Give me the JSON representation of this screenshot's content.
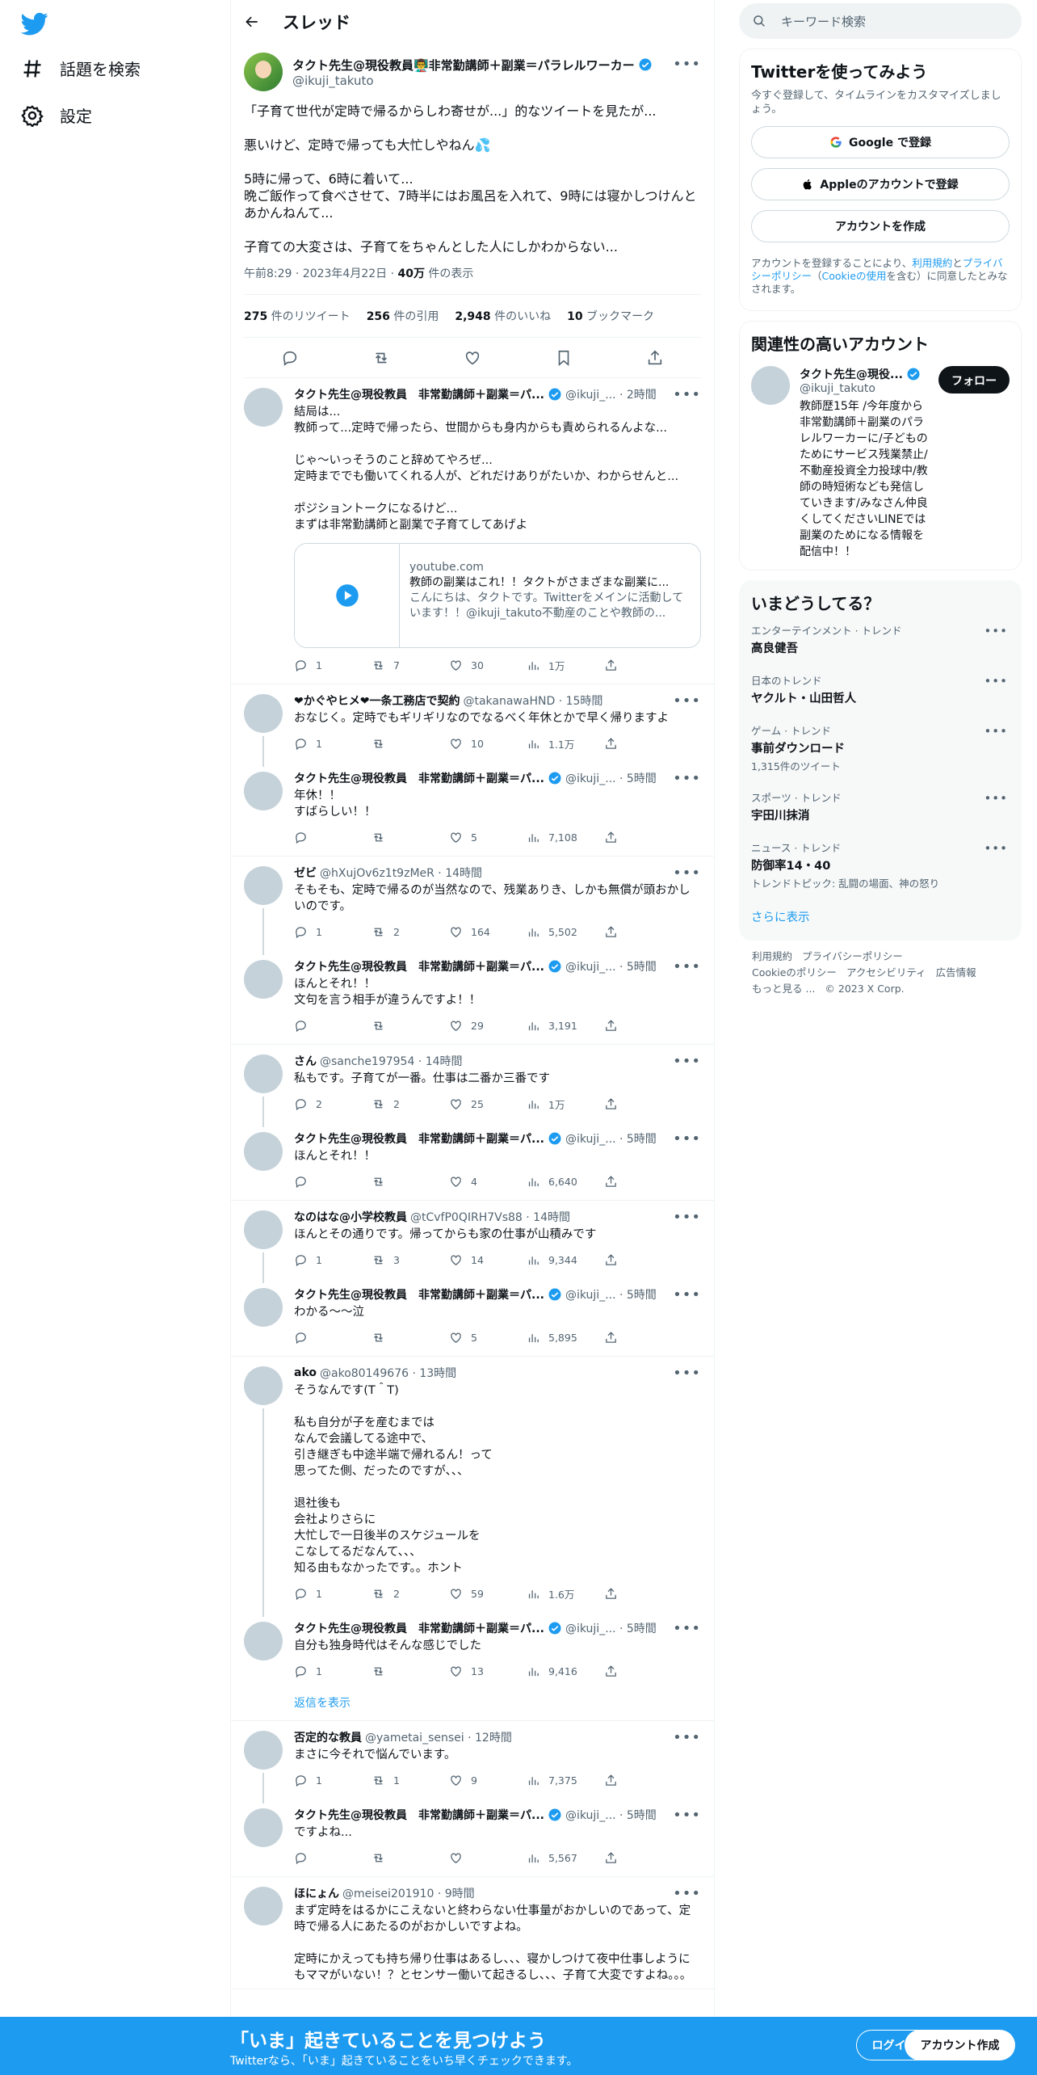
{
  "colors": {
    "accent": "#1d9bf0",
    "text": "#0f1419",
    "muted": "#536471"
  },
  "nav": {
    "explore": "話題を検索",
    "settings": "設定"
  },
  "header": {
    "title": "スレッド"
  },
  "focal": {
    "name": "タクト先生@現役教員👨‍🏫非常勤講師＋副業＝パラレルワーカー",
    "handle": "@ikuji_takuto",
    "text": "「子育て世代が定時で帰るからしわ寄せが...」的なツイートを見たが...\n\n悪いけど、定時で帰っても大忙しやねん💦\n\n5時に帰って、6時に着いて...\n晩ご飯作って食べさせて、7時半にはお風呂を入れて、9時には寝かしつけんとあかんねんて...\n\n子育ての大変さは、子育てをちゃんとした人にしかわからない...",
    "time": "午前8:29 · 2023年4月22日 · ",
    "views": "40万",
    "views_label": " 件の表示",
    "stats": [
      {
        "n": "275",
        "l": " 件のリツイート"
      },
      {
        "n": "256",
        "l": " 件の引用"
      },
      {
        "n": "2,948",
        "l": " 件のいいね"
      },
      {
        "n": "10",
        "l": " ブックマーク"
      }
    ]
  },
  "tweets": [
    {
      "name": "タクト先生@現役教員　非常勤講師＋副業＝パ...",
      "handle": "@ikuji_... · 2時間",
      "text": "結局は...\n教師って...定時で帰ったら、世間からも身内からも責められるんよな...\n\nじゃ〜いっそうのこと辞めてやろぜ...\n定時まででも働いてくれる人が、どれだけありがたいか、わからせんと...\n\nポジショントークになるけど...\nまずは非常勤講師と副業で子育てしてあげよ",
      "reply": "1",
      "rt": "7",
      "like": "30",
      "view": "1万",
      "card": {
        "domain": "youtube.com",
        "title": "教師の副業はこれ！！タクトがさまざまな副業に...",
        "desc": "こんにちは、タクトです。Twitterをメインに活動しています！！@ikuji_takuto不動産のことや教師の..."
      }
    },
    {
      "name": "❤かぐやヒメ❤一条工務店で契約",
      "handle": "@takanawaHND · 15時間",
      "text": "おなじく。定時でもギリギリなのでなるべく年休とかで早く帰りますよ",
      "reply": "1",
      "rt": "",
      "like": "10",
      "view": "1.1万"
    },
    {
      "name": "タクト先生@現役教員　非常勤講師＋副業＝パ...",
      "handle": "@ikuji_... · 5時間",
      "text": "年休！！\nすばらしい！！",
      "reply": "",
      "rt": "",
      "like": "5",
      "view": "7,108"
    },
    {
      "name": "ゼビ",
      "handle": "@hXujOv6z1t9zMeR · 14時間",
      "text": "そもそも、定時で帰るのが当然なので、残業ありき、しかも無償が頭おかしいのです。",
      "reply": "1",
      "rt": "2",
      "like": "164",
      "view": "5,502"
    },
    {
      "name": "タクト先生@現役教員　非常勤講師＋副業＝パ...",
      "handle": "@ikuji_... · 5時間",
      "text": "ほんとそれ！！\n文句を言う相手が違うんですよ！！",
      "reply": "",
      "rt": "",
      "like": "29",
      "view": "3,191"
    },
    {
      "name": "さん",
      "handle": "@sanche197954 · 14時間",
      "text": "私もです。子育てが一番。仕事は二番か三番です",
      "reply": "2",
      "rt": "2",
      "like": "25",
      "view": "1万"
    },
    {
      "name": "タクト先生@現役教員　非常勤講師＋副業＝パ...",
      "handle": "@ikuji_... · 5時間",
      "text": "ほんとそれ！！",
      "reply": "",
      "rt": "",
      "like": "4",
      "view": "6,640"
    },
    {
      "name": "なのはな@小学校教員",
      "handle": "@tCvfP0QIRH7Vs88 · 14時間",
      "text": "ほんとその通りです。帰ってからも家の仕事が山積みです",
      "reply": "1",
      "rt": "3",
      "like": "14",
      "view": "9,344"
    },
    {
      "name": "タクト先生@現役教員　非常勤講師＋副業＝パ...",
      "handle": "@ikuji_... · 5時間",
      "text": "わかる〜〜泣",
      "reply": "",
      "rt": "",
      "like": "5",
      "view": "5,895"
    },
    {
      "name": "ako",
      "handle": "@ako80149676 · 13時間",
      "text": "そうなんです(T＾T)\n\n私も自分が子を産むまでは\nなんで会議してる途中で、\n引き継ぎも中途半端で帰れるん！って\n思ってた側、だったのですが、、、\n\n退社後も\n会社よりさらに\n大忙しで一日後半のスケジュールを\nこなしてるだなんて、、、\n知る由もなかったです。。ホント",
      "reply": "1",
      "rt": "2",
      "like": "59",
      "view": "1.6万"
    },
    {
      "name": "タクト先生@現役教員　非常勤講師＋副業＝パ...",
      "handle": "@ikuji_... · 5時間",
      "text": "自分も独身時代はそんな感じでした",
      "reply": "1",
      "rt": "",
      "like": "13",
      "view": "9,416"
    },
    {
      "name": "否定的な教員",
      "handle": "@yametai_sensei · 12時間",
      "text": "まさに今それで悩んでいます。",
      "reply": "1",
      "rt": "1",
      "like": "9",
      "view": "7,375"
    },
    {
      "name": "タクト先生@現役教員　非常勤講師＋副業＝パ...",
      "handle": "@ikuji_... · 5時間",
      "text": "ですよね...",
      "reply": "",
      "rt": "",
      "like": "",
      "view": "5,567"
    },
    {
      "name": "ほにょん",
      "handle": "@meisei201910 · 9時間",
      "text": "まず定時をはるかにこえないと終わらない仕事量がおかしいのであって、定時で帰る人にあたるのがおかしいですよね。\n\n定時にかえっても持ち帰り仕事はあるし、、、寝かしつけて夜中仕事しようにもママがいない！？とセンサー働いて起きるし、、、子育て大変ですよね。。。",
      "reply": "",
      "rt": "",
      "like": "",
      "view": ""
    }
  ],
  "show_replies": "返信を表示",
  "right": {
    "search_placeholder": "キーワード検索",
    "signup": {
      "title": "Twitterを使ってみよう",
      "sub": "今すぐ登録して、タイムラインをカスタマイズしましょう。",
      "google": "Google で登録",
      "apple": "Appleのアカウントで登録",
      "create": "アカウントを作成",
      "legal1": "アカウントを登録することにより、",
      "terms": "利用規約",
      "and": "と",
      "privacy": "プライバシーポリシー",
      "legal2": "（",
      "cookie": "Cookieの使用",
      "legal3": "を含む）に同意したとみなされます。"
    },
    "related": {
      "title": "関連性の高いアカウント",
      "name": "タクト先生@現役...",
      "handle": "@ikuji_takuto",
      "follow": "フォロー",
      "bio": "教師歴15年 /今年度から非常勤講師＋副業のパラレルワーカーに/子どものためにサービス残業禁止/不動産投資全力投球中/教師の時短術なども発信していきます/みなさん仲良くしてくださいLINEでは副業のためになる情報を配信中！！"
    },
    "trends": {
      "title": "いまどうしてる？",
      "items": [
        {
          "cat": "エンターテインメント · トレンド",
          "name": "高良健吾",
          "cnt": ""
        },
        {
          "cat": "日本のトレンド",
          "name": "ヤクルト・山田哲人",
          "cnt": ""
        },
        {
          "cat": "ゲーム · トレンド",
          "name": "事前ダウンロード",
          "cnt": "1,315件のツイート"
        },
        {
          "cat": "スポーツ · トレンド",
          "name": "宇田川抹消",
          "cnt": ""
        },
        {
          "cat": "ニュース · トレンド",
          "name": "防御率14・40",
          "cnt": "トレンドトピック: 乱闘の場面、神の怒り"
        }
      ],
      "more": "さらに表示"
    },
    "footer": [
      "利用規約",
      "プライバシーポリシー",
      "Cookieのポリシー",
      "アクセシビリティ",
      "広告情報",
      "もっと見る ...",
      "© 2023 X Corp."
    ]
  },
  "bottom": {
    "title": "「いま」起きていることを見つけよう",
    "sub": "Twitterなら、「いま」起きていることをいち早くチェックできます。",
    "login": "ログイン",
    "signup": "アカウント作成"
  }
}
